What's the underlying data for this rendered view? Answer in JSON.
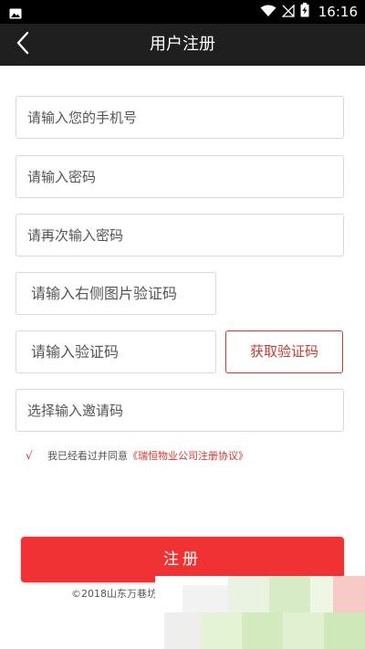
{
  "status_bar": {
    "time": "16:16",
    "icons": [
      "photo-icon",
      "wifi-icon",
      "signal-icon",
      "battery-charging-icon"
    ]
  },
  "header": {
    "title": "用户注册",
    "back_icon": "back-arrow-icon"
  },
  "form": {
    "phone_placeholder": "请输入您的手机号",
    "password_placeholder": "请输入密码",
    "password_confirm_placeholder": "请再次输入密码",
    "image_captcha_placeholder": "请输入右侧图片验证码",
    "sms_code_placeholder": "请输入验证码",
    "get_code_label": "获取验证码",
    "invite_code_placeholder": "选择输入邀请码"
  },
  "agreement": {
    "check_mark": "√",
    "text": "我已经看过并同意",
    "link": "《瑞恒物业公司注册协议》"
  },
  "register_label": "注册",
  "copyright": "©2018山东万巷坊网络",
  "colors": {
    "accent": "#f03234",
    "title_bar": "#1f1f1f",
    "status_bar": "#000000"
  }
}
